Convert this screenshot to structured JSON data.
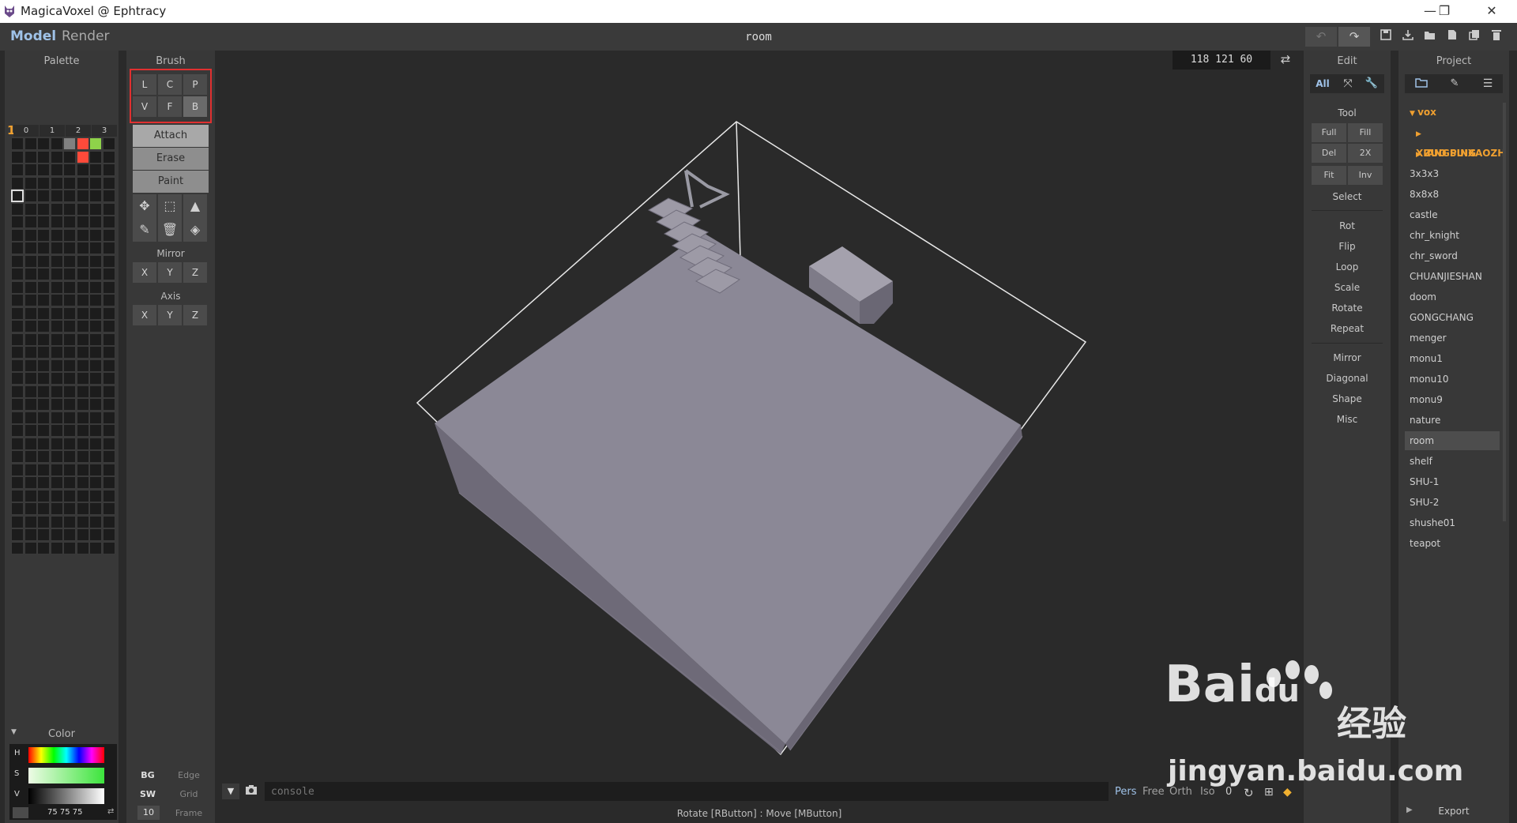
{
  "window": {
    "title": "MagicaVoxel @ Ephtracy",
    "minimize": "—",
    "maximize": "❐",
    "close": "✕"
  },
  "menu": {
    "model": "Model",
    "render": "Render",
    "doc_title": "room"
  },
  "toolbar_icons": [
    "undo-icon",
    "redo-icon",
    "save-icon",
    "export-icon",
    "open-icon",
    "new-icon",
    "copy-icon",
    "delete-icon"
  ],
  "palette": {
    "header": "Palette",
    "tabs": [
      "0",
      "1",
      "2",
      "3"
    ],
    "marker": "1",
    "colors": {
      "c1": "#808080",
      "c2": "#ff4a3a",
      "c3": "#8ed24a",
      "c4": "#ff4a3a"
    },
    "color_header": "Color",
    "h_label": "H",
    "s_label": "S",
    "v_label": "V",
    "rgb_value": "75 75 75"
  },
  "brush": {
    "header": "Brush",
    "row1": [
      "L",
      "C",
      "P"
    ],
    "row2": [
      "V",
      "F",
      "B"
    ],
    "modes": [
      "Attach",
      "Erase",
      "Paint"
    ],
    "mirror_label": "Mirror",
    "mirror": [
      "X",
      "Y",
      "Z"
    ],
    "axis_label": "Axis",
    "axis": [
      "X",
      "Y",
      "Z"
    ],
    "bottom": {
      "bg": "BG",
      "edge": "Edge",
      "sw": "SW",
      "grid": "Grid",
      "num": "10",
      "frame": "Frame"
    }
  },
  "viewport": {
    "coords": "118  121  60",
    "console_placeholder": "console",
    "status": "Rotate [RButton] : Move [MButton]",
    "view_modes": [
      "Pers",
      "Free",
      "Orth",
      "Iso"
    ],
    "view_value": "0"
  },
  "edit": {
    "header": "Edit",
    "all": "All",
    "tool_label": "Tool",
    "tool_buttons": [
      "Full",
      "Fill",
      "Del",
      "2X",
      "Fit",
      "Inv"
    ],
    "select": "Select",
    "transforms": [
      "Rot",
      "Flip",
      "Loop",
      "Scale",
      "Rotate",
      "Repeat"
    ],
    "misc": [
      "Mirror",
      "Diagonal",
      "Shape",
      "Misc"
    ]
  },
  "project": {
    "header": "Project",
    "root": "vox",
    "folders": [
      "XIANGSUIXAOZH",
      "ZUO PING"
    ],
    "items": [
      "3x3x3",
      "8x8x8",
      "castle",
      "chr_knight",
      "chr_sword",
      "CHUANJIESHAN",
      "doom",
      "GONGCHANG",
      "menger",
      "monu1",
      "monu10",
      "monu9",
      "nature",
      "room",
      "shelf",
      "SHU-1",
      "SHU-2",
      "shushe01",
      "teapot"
    ],
    "selected": "room",
    "export": "Export"
  },
  "watermark": {
    "text1": "Bai",
    "text2": "经验",
    "url": "jingyan.baidu.com"
  }
}
